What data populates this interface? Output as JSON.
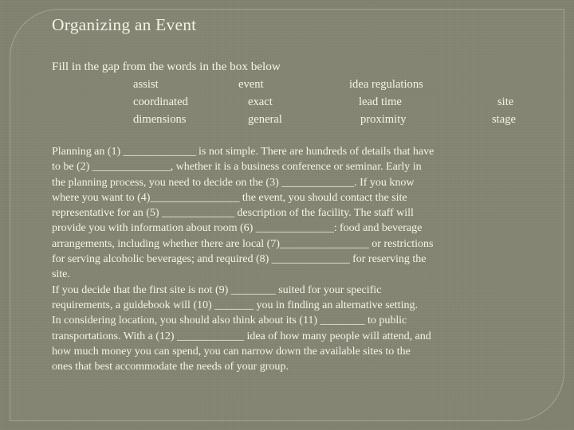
{
  "slide": {
    "title": "Organizing an Event",
    "prompt": "Fill in the gap from the words in the box below",
    "background_color": "#80826e",
    "text_color": "#f3f4e9",
    "panel_border_color": "rgba(235,238,220,0.30)"
  },
  "word_bank": {
    "rows": [
      {
        "c1": "assist",
        "c2": "event",
        "c3": "idea regulations",
        "c4": ""
      },
      {
        "c1": "coordinated",
        "c2": "exact",
        "c3": "lead time",
        "c4": "site"
      },
      {
        "c1": "dimensions",
        "c2": "general",
        "c3": "proximity",
        "c4": "stage"
      }
    ],
    "words": [
      "assist",
      "event",
      "idea regulations",
      "coordinated",
      "exact",
      "lead time",
      "site",
      "dimensions",
      "general",
      "proximity",
      "stage"
    ]
  },
  "body": {
    "lines": [
      "Planning an (1) _____________ is not simple. There are hundreds of details that have",
      "to be (2) ______________, whether it is a business conference  or seminar. Early in",
      "the planning process, you need to decide on the (3) _____________. If you know",
      "where you want to (4)________________ the event, you should contact the site",
      "representative for an    (5) _____________ description of the facility. The staff will",
      "provide you with information about room (6) ______________: food and beverage",
      "arrangements, including whether there are local (7)________________ or restrictions",
      "for serving alcoholic beverages; and required (8) ______________ for reserving the",
      "site.",
      "If you decide that the first site is not (9) ________ suited for your specific",
      "requirements, a guidebook will (10) _______ you in finding an alternative setting.",
      "In considering location, you should also think about its (11) ________ to public",
      "transportations. With a (12) ____________ idea of how many people will attend, and",
      "how much money you can spend, you can narrow down the available sites to the",
      "ones that best accommodate the needs of your group."
    ]
  }
}
